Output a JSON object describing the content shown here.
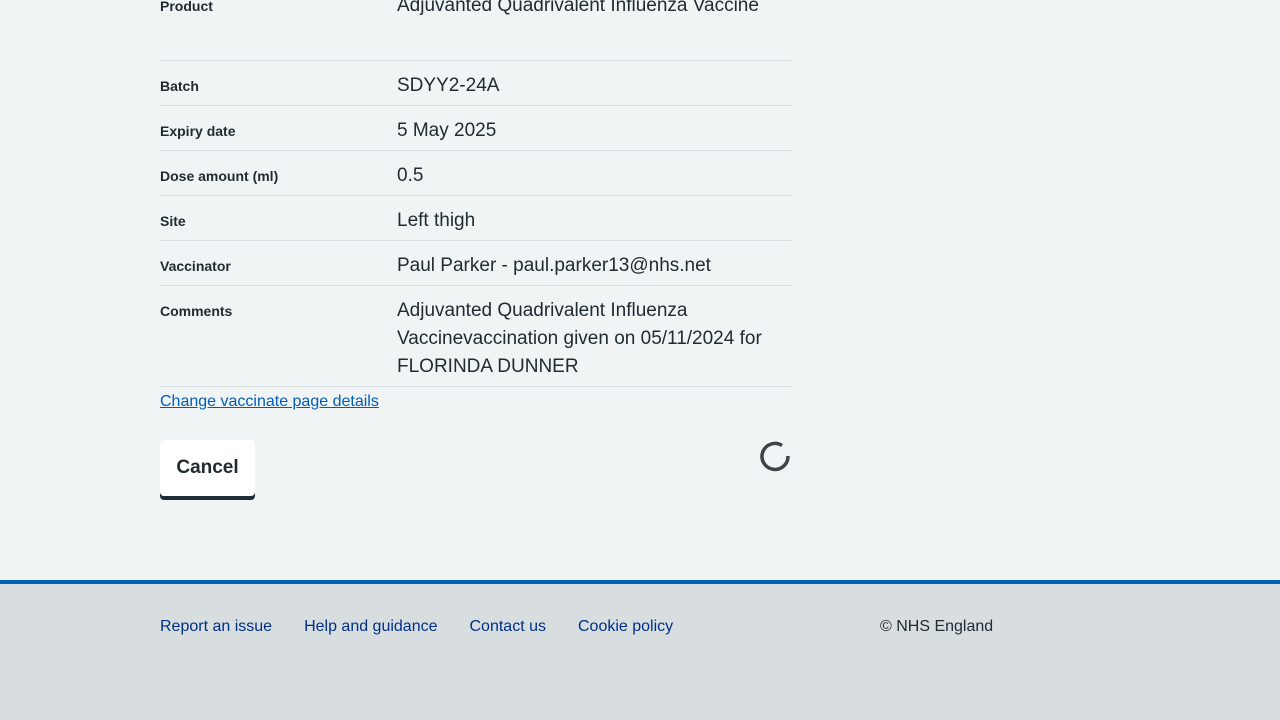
{
  "summary": {
    "rows": [
      {
        "key": "Product",
        "value": "Adjuvanted Quadrivalent Influenza Vaccine"
      },
      {
        "key": "Batch",
        "value": "SDYY2-24A"
      },
      {
        "key": "Expiry date",
        "value": "5 May 2025"
      },
      {
        "key": "Dose amount (ml)",
        "value": "0.5"
      },
      {
        "key": "Site",
        "value": "Left thigh"
      },
      {
        "key": "Vaccinator",
        "value": "Paul Parker - paul.parker13@nhs.net"
      },
      {
        "key": "Comments",
        "value": "Adjuvanted Quadrivalent Influenza Vaccinevaccination given on 05/11/2024 for FLORINDA DUNNER"
      }
    ]
  },
  "actions": {
    "change_link": "Change vaccinate page details",
    "cancel_label": "Cancel",
    "spinner_icon": "loading-spinner-icon"
  },
  "footer": {
    "links": [
      "Report an issue",
      "Help and guidance",
      "Contact us",
      "Cookie policy"
    ],
    "copyright": "© NHS England"
  },
  "colors": {
    "background": "#f0f4f5",
    "link": "#005eb8",
    "footer_link": "#003087",
    "footer_bg": "#d8dde0",
    "text": "#212b32"
  }
}
